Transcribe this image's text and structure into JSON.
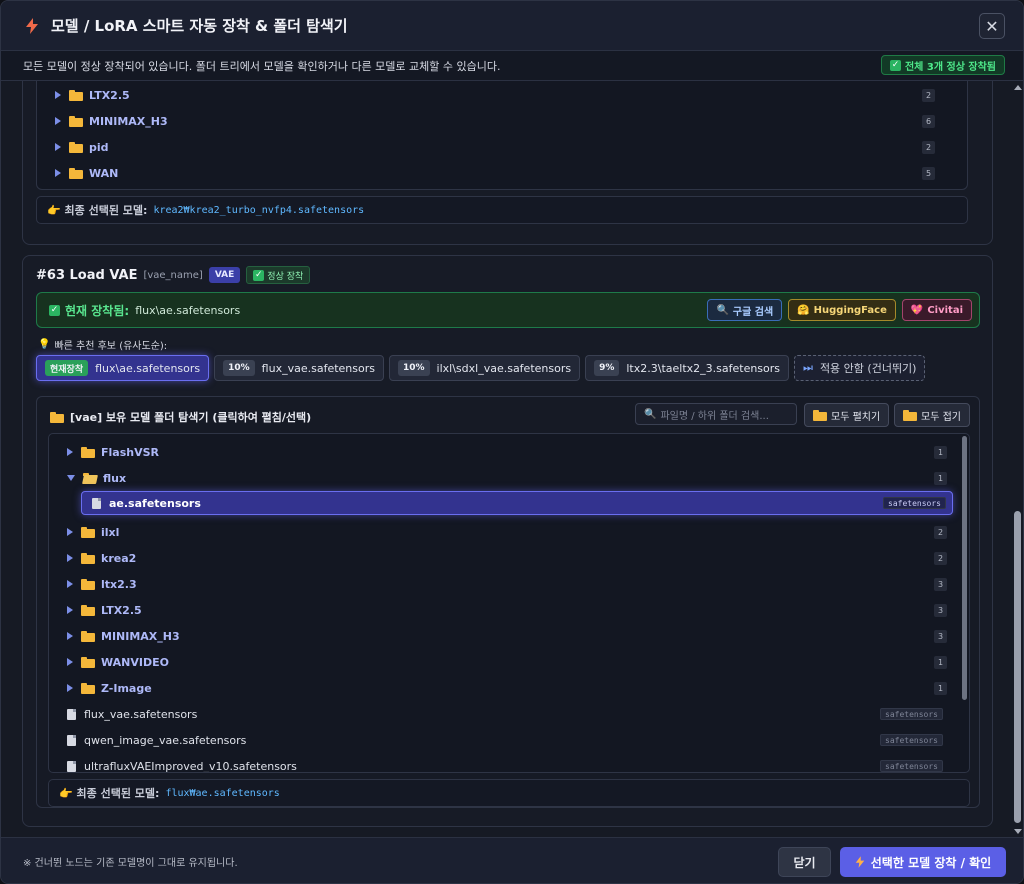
{
  "window": {
    "title": "모델 / LoRA 스마트 자동 장착 & 폴더 탐색기",
    "close_label": "✕"
  },
  "status": {
    "message": "모든 모델이 정상 장착되어 있습니다. 폴더 트리에서 모델을 확인하거나 다른 모델로 교체할 수 있습니다.",
    "badge": "전체 3개 정상 장착됨",
    "badge_color": "#4ee88a"
  },
  "card1": {
    "tree": [
      {
        "name": "LTX2.5",
        "count": "2"
      },
      {
        "name": "MINIMAX_H3",
        "count": "6"
      },
      {
        "name": "pid",
        "count": "2"
      },
      {
        "name": "WAN",
        "count": "5"
      }
    ],
    "final_label": "👉 최종 선택된 모델:",
    "final_path": "krea2₩krea2_turbo_nvfp4.safetensors"
  },
  "card2": {
    "node_title": "#63 Load VAE",
    "node_param": "[vae_name]",
    "type_badge": "VAE",
    "state_badge": "정상 장착",
    "current_label": "현재 장착됨:",
    "current_value": "flux\\ae.safetensors",
    "ext_buttons": {
      "google": "구글 검색",
      "huggingface": "HuggingFace",
      "civitai": "Civitai"
    },
    "reco_title": "빠른 추천 후보 (유사도순):",
    "reco": [
      {
        "pct": "현재장착",
        "name": "flux\\ae.safetensors"
      },
      {
        "pct": "10%",
        "name": "flux_vae.safetensors"
      },
      {
        "pct": "10%",
        "name": "ilxl\\sdxl_vae.safetensors"
      },
      {
        "pct": "9%",
        "name": "ltx2.3\\taeltx2_3.safetensors"
      }
    ],
    "skip_label": "적용 안함 (건너뛰기)",
    "browser": {
      "title": "[vae] 보유 모델 폴더 탐색기 (클릭하여 펼침/선택)",
      "search_placeholder": "파일명 / 하위 폴더 검색...",
      "expand_all": "모두 펼치기",
      "collapse_all": "모두 접기",
      "folders": [
        {
          "name": "FlashVSR",
          "count": "1"
        },
        {
          "name": "flux",
          "count": "1"
        },
        {
          "name": "ilxl",
          "count": "2"
        },
        {
          "name": "krea2",
          "count": "2"
        },
        {
          "name": "ltx2.3",
          "count": "3"
        },
        {
          "name": "LTX2.5",
          "count": "3"
        },
        {
          "name": "MINIMAX_H3",
          "count": "3"
        },
        {
          "name": "WANVIDEO",
          "count": "1"
        },
        {
          "name": "Z-Image",
          "count": "1"
        }
      ],
      "selected_file": {
        "name": "ae.safetensors",
        "ext": "safetensors"
      },
      "files": [
        {
          "name": "flux_vae.safetensors",
          "ext": "safetensors"
        },
        {
          "name": "qwen_image_vae.safetensors",
          "ext": "safetensors"
        },
        {
          "name": "ultrafluxVAEImproved_v10.safetensors",
          "ext": "safetensors"
        }
      ]
    },
    "final_label": "👉 최종 선택된 모델:",
    "final_path": "flux₩ae.safetensors"
  },
  "footer": {
    "note": "※ 건너뛴 노드는 기존 모델명이 그대로 유지됩니다.",
    "close_button": "닫기",
    "apply_button": "선택한 모델 장착 / 확인",
    "accent_color": "#5b5fe6"
  }
}
